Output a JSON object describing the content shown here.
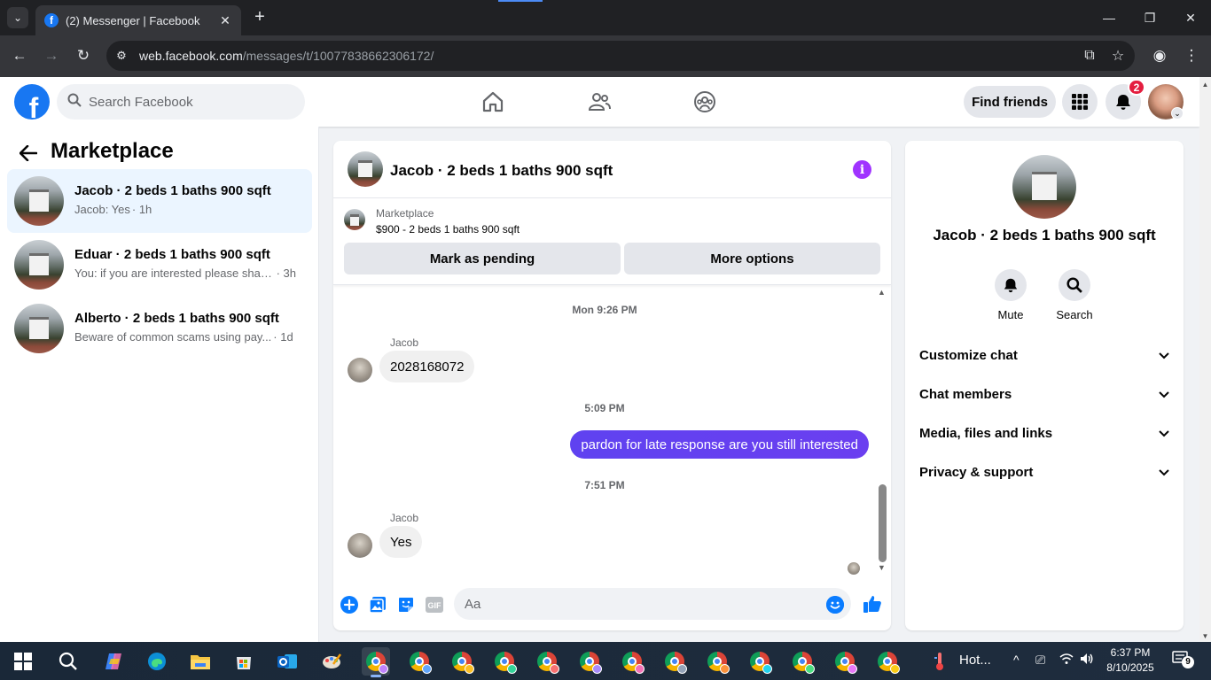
{
  "browser": {
    "tab_title": "(2) Messenger | Facebook",
    "tab_favicon": "f",
    "url_host": "web.facebook.com",
    "url_path": "/messages/t/10077838662306172/"
  },
  "fb_header": {
    "search_placeholder": "Search Facebook",
    "find_friends_label": "Find friends",
    "notification_count": "2"
  },
  "sidebar": {
    "title": "Marketplace",
    "conversations": [
      {
        "name": "Jacob · 2 beds 1 baths 900 sqft",
        "preview": "Jacob: Yes",
        "time": "· 1h",
        "active": true
      },
      {
        "name": "Eduar · 2 beds 1 baths 900 sqft",
        "preview": "You: if you are interested please share...",
        "time": "· 3h",
        "active": false
      },
      {
        "name": "Alberto · 2 beds 1 baths 900 sqft",
        "preview": "Beware of common scams using pay...",
        "time": "· 1d",
        "active": false
      }
    ]
  },
  "chat": {
    "title": "Jacob · 2 beds 1 baths 900 sqft",
    "listing_label": "Marketplace",
    "listing_price": "$900 - 2 beds 1 baths 900 sqft",
    "mark_pending_label": "Mark as pending",
    "more_options_label": "More options",
    "messages": {
      "sep1": "Mon 9:26 PM",
      "sender1": "Jacob",
      "msg1": "2028168072",
      "sep2": "5:09 PM",
      "msg2": "pardon for late response are you still interested",
      "sep3": "7:51 PM",
      "sender3": "Jacob",
      "msg3": "Yes"
    },
    "composer_placeholder": "Aa",
    "gif_label": "GIF"
  },
  "info_panel": {
    "name": "Jacob · 2 beds 1 baths 900 sqft",
    "mute_label": "Mute",
    "search_label": "Search",
    "rows": [
      "Customize chat",
      "Chat members",
      "Media, files and links",
      "Privacy & support"
    ]
  },
  "taskbar": {
    "weather_label": "Hot...",
    "time": "6:37 PM",
    "date": "8/10/2025",
    "notif_count": "9"
  },
  "colors": {
    "fb_blue": "#1877f2",
    "outgoing_bubble": "#5f42f0",
    "info_purple": "#a033ff",
    "badge_red": "#e41e3f"
  }
}
